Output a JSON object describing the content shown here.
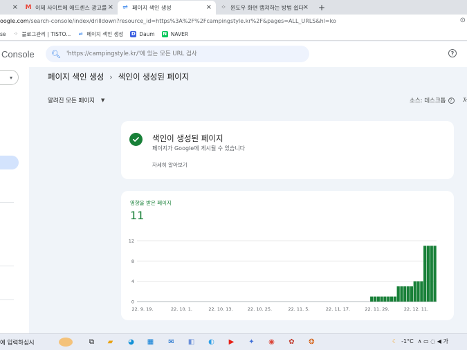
{
  "browser": {
    "tabs": [
      {
        "label": "이제 사이트에 애드센스 광고를",
        "favicon": "gmail-icon",
        "active": false
      },
      {
        "label": "페이지 색인 생성",
        "favicon": "search-console-icon",
        "active": true
      },
      {
        "label": "윈도우 화면 캡쳐하는 방법 쉽다",
        "favicon": "tistory-icon",
        "active": false
      }
    ],
    "new_tab": "+",
    "close": "×",
    "url_prefix": "oogle.com",
    "url_rest": "/search-console/index/drilldown?resource_id=https%3A%2F%2Fcampingstyle.kr%2F&pages=ALL_URLS&hl=ko",
    "bookmarks": [
      {
        "label": "se",
        "icon": "generic-icon"
      },
      {
        "label": "블로그관리 | TISTO...",
        "icon": "tistory-icon"
      },
      {
        "label": "페이지 색인 생성",
        "icon": "search-console-icon"
      },
      {
        "label": "Daum",
        "icon": "daum-icon"
      },
      {
        "label": "NAVER",
        "icon": "naver-icon"
      }
    ]
  },
  "header": {
    "app_name": "Console",
    "search_placeholder": "'https://campingstyle.kr/'에 있는 모든 URL 검사",
    "help": "?"
  },
  "main": {
    "breadcrumb_parent": "페이지 색인 생성",
    "breadcrumb_sep": "›",
    "breadcrumb_current": "색인이 생성된 페이지",
    "filter_label": "알려진 모든 페이지",
    "source_label": "소스: 데스크톱",
    "source_help": "?",
    "edge_text": "저"
  },
  "status_card": {
    "title": "색인이 생성된 페이지",
    "description": "페이지가 Google에 게시될 수 있습니다",
    "learn_more": "자세히 알아보기"
  },
  "impact_card": {
    "label": "영향을 받은 페이지",
    "count": "11"
  },
  "chart_data": {
    "type": "bar",
    "title": "",
    "xlabel": "",
    "ylabel": "",
    "ylim": [
      0,
      12
    ],
    "yticks": [
      "0",
      "4",
      "8",
      "12"
    ],
    "xtick_labels": [
      "22. 9. 19.",
      "22. 10. 1.",
      "22. 10. 13.",
      "22. 10. 25.",
      "22. 11. 5.",
      "22. 11. 17.",
      "22. 11. 29.",
      "22. 12. 11."
    ],
    "values": [
      0,
      0,
      0,
      0,
      0,
      0,
      0,
      0,
      0,
      0,
      0,
      0,
      0,
      0,
      0,
      0,
      0,
      0,
      0,
      0,
      0,
      0,
      0,
      0,
      0,
      0,
      0,
      0,
      0,
      0,
      0,
      0,
      0,
      0,
      0,
      0,
      0,
      0,
      0,
      0,
      0,
      0,
      0,
      0,
      0,
      0,
      0,
      0,
      0,
      0,
      0,
      0,
      0,
      0,
      0,
      0,
      0,
      0,
      0,
      0,
      0,
      0,
      0,
      0,
      0,
      0,
      0,
      0,
      0,
      0,
      1,
      1,
      1,
      1,
      1,
      1,
      1,
      1,
      3,
      3,
      3,
      3,
      3,
      4,
      4,
      4,
      11,
      11,
      11,
      11
    ],
    "bar_color": "#188038",
    "grid": true
  },
  "taskbar": {
    "search_text": "에 입력하십시",
    "weather": "-1°C",
    "tray_extra": "∧ ▭ ◌ ◀ 가"
  }
}
